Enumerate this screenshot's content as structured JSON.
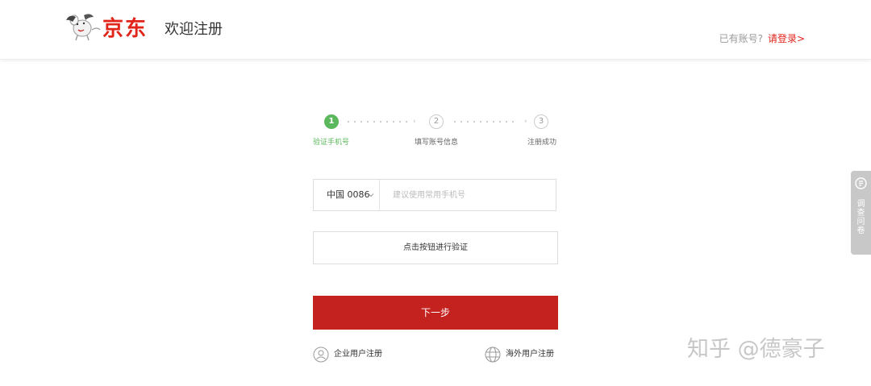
{
  "header": {
    "logo_text": "京东",
    "title": "欢迎注册",
    "login_prompt": "已有账号?",
    "login_link": "请登录>"
  },
  "steps": [
    {
      "number": "1",
      "label": "验证手机号",
      "active": true
    },
    {
      "number": "2",
      "label": "填写账号信息",
      "active": false
    },
    {
      "number": "3",
      "label": "注册成功",
      "active": false
    }
  ],
  "phone": {
    "country_code": "中国 0086",
    "placeholder": "建议使用常用手机号"
  },
  "verify_button": "点击按钮进行验证",
  "next_button": "下一步",
  "bottom_links": {
    "enterprise": "企业用户注册",
    "overseas": "海外用户注册"
  },
  "survey_tab": "调查问卷",
  "watermark": "知乎 @德豪子",
  "colors": {
    "brand_red": "#e1251b",
    "button_red": "#c4221f",
    "step_active_green": "#5cb85c"
  },
  "icons": {
    "logo": "jd-dog-mascot-icon",
    "country_dropdown": "chevron-down-icon",
    "enterprise": "user-circle-icon",
    "overseas": "globe-icon",
    "survey": "survey-icon"
  }
}
